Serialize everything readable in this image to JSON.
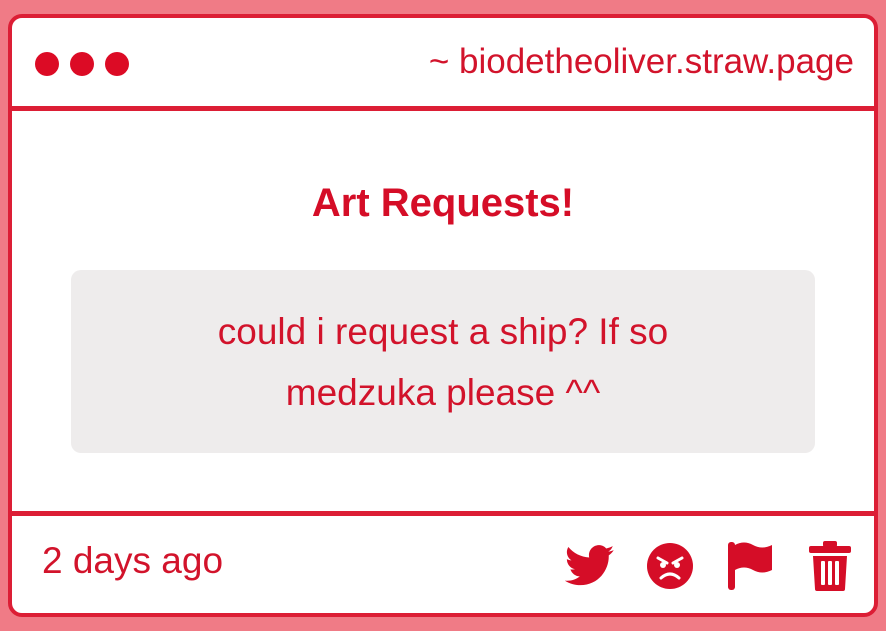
{
  "window": {
    "url": "~ biodetheoliver.straw.page"
  },
  "main": {
    "heading": "Art Requests!",
    "message": "could i request a ship? If so medzuka please ^^"
  },
  "footer": {
    "timestamp": "2 days ago",
    "actions": [
      {
        "icon": "twitter-icon"
      },
      {
        "icon": "angry-face-icon"
      },
      {
        "icon": "flag-icon"
      },
      {
        "icon": "trash-icon"
      }
    ]
  },
  "colors": {
    "accent": "#dc1e35",
    "background": "#f07b86",
    "message_box": "#eeecec"
  }
}
